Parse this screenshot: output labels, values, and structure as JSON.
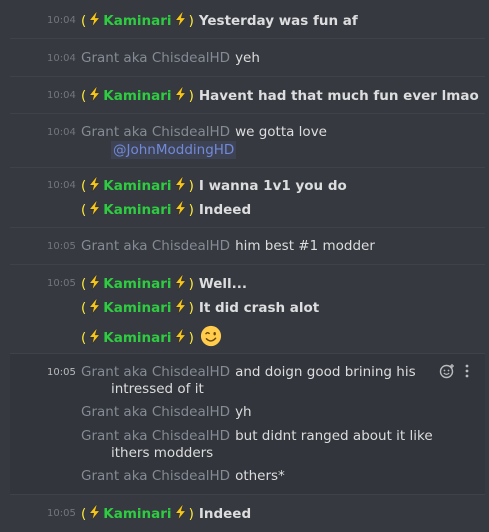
{
  "names": {
    "kaminari": "Kaminari",
    "kaminari_open": "(",
    "kaminari_close": ")",
    "grant": "Grant aka ChisdealHD"
  },
  "colors": {
    "background": "#36393f",
    "kaminari_name": "#2ecc40",
    "grant_name": "#848b94",
    "mention": "#7289da",
    "timestamp": "#72767d",
    "text": "#dcddde"
  },
  "icons": {
    "bolt": "high-voltage-emoji",
    "wink": "winking-face-emoji",
    "reaction": "add-reaction-icon",
    "more": "more-options-icon"
  },
  "messages": [
    {
      "time": "10:04",
      "author": "kaminari",
      "text": "Yesterday was fun af"
    },
    {
      "time": "10:04",
      "author": "grant",
      "text": "yeh"
    },
    {
      "time": "10:04",
      "author": "kaminari",
      "text": "Havent had that much fun ever lmao"
    },
    {
      "time": "10:04",
      "author": "grant",
      "text": "we gotta love",
      "mention": "@JohnModdingHD"
    },
    {
      "time": "10:04",
      "author": "kaminari",
      "text": "I wanna 1v1 you do"
    },
    {
      "time": "",
      "author": "kaminari",
      "text": "Indeed"
    },
    {
      "time": "10:05",
      "author": "grant",
      "text": "him best #1 modder"
    },
    {
      "time": "10:05",
      "author": "kaminari",
      "text": "Well..."
    },
    {
      "time": "",
      "author": "kaminari",
      "text": "It did crash alot"
    },
    {
      "time": "",
      "author": "kaminari",
      "text": ""
    },
    {
      "time": "10:05",
      "author": "grant",
      "text": "and doign good brining his",
      "cont": "intressed of it"
    },
    {
      "time": "",
      "author": "grant",
      "text": "yh"
    },
    {
      "time": "",
      "author": "grant",
      "text": "but didnt ranged about it like",
      "cont": "ithers modders"
    },
    {
      "time": "",
      "author": "grant",
      "text": "others*"
    },
    {
      "time": "10:05",
      "author": "kaminari",
      "text": "Indeed"
    }
  ]
}
